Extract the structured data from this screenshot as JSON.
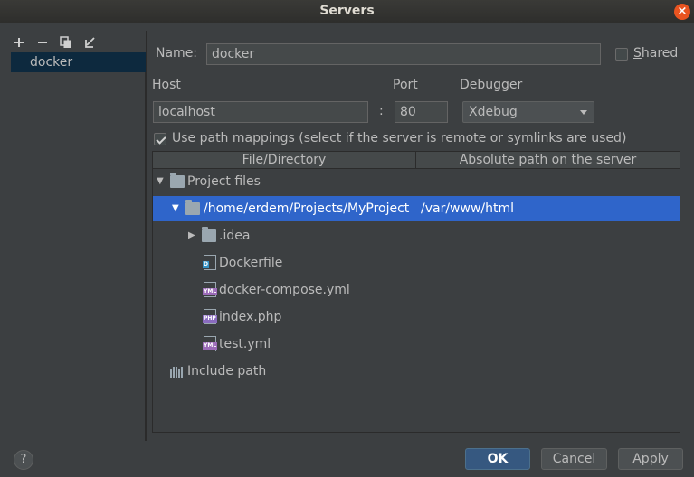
{
  "window": {
    "title": "Servers"
  },
  "toolbar": {
    "add_icon": "plus-icon",
    "remove_icon": "minus-icon",
    "copy_icon": "copy-icon",
    "import_icon": "import-icon"
  },
  "servers": {
    "items": [
      {
        "label": "docker",
        "selected": true
      }
    ]
  },
  "form": {
    "name_label": "Name:",
    "name_value": "docker",
    "shared_label": "Shared",
    "shared_checked": false,
    "host_label": "Host",
    "host_value": "localhost",
    "port_separator": ":",
    "port_label": "Port",
    "port_value": "80",
    "debugger_label": "Debugger",
    "debugger_value": "Xdebug",
    "use_mappings_label": "Use path mappings (select if the server is remote or symlinks are used)",
    "use_mappings_checked": true
  },
  "mappings": {
    "columns": [
      "File/Directory",
      "Absolute path on the server"
    ],
    "rows": [
      {
        "label": "Project files",
        "icon": "folder-icon",
        "expanded": true
      },
      {
        "label": "/home/erdem/Projects/MyProject",
        "server_path": "/var/www/html",
        "icon": "folder-icon",
        "expanded": true,
        "selected": true
      },
      {
        "label": ".idea",
        "icon": "folder-icon",
        "expanded": false
      },
      {
        "label": "Dockerfile",
        "icon": "dockerfile-icon",
        "tag": "D"
      },
      {
        "label": "docker-compose.yml",
        "icon": "yml-file-icon",
        "tag": "YML"
      },
      {
        "label": "index.php",
        "icon": "php-file-icon",
        "tag": "PHP"
      },
      {
        "label": "test.yml",
        "icon": "yml-file-icon",
        "tag": "YML"
      },
      {
        "label": "Include path",
        "icon": "library-icon"
      }
    ]
  },
  "buttons": {
    "help": "?",
    "ok": "OK",
    "cancel": "Cancel",
    "apply": "Apply"
  },
  "colors": {
    "background": "#3c3f41",
    "selection": "#2f65ca",
    "primary_button": "#365880",
    "close_button": "#e95420"
  }
}
